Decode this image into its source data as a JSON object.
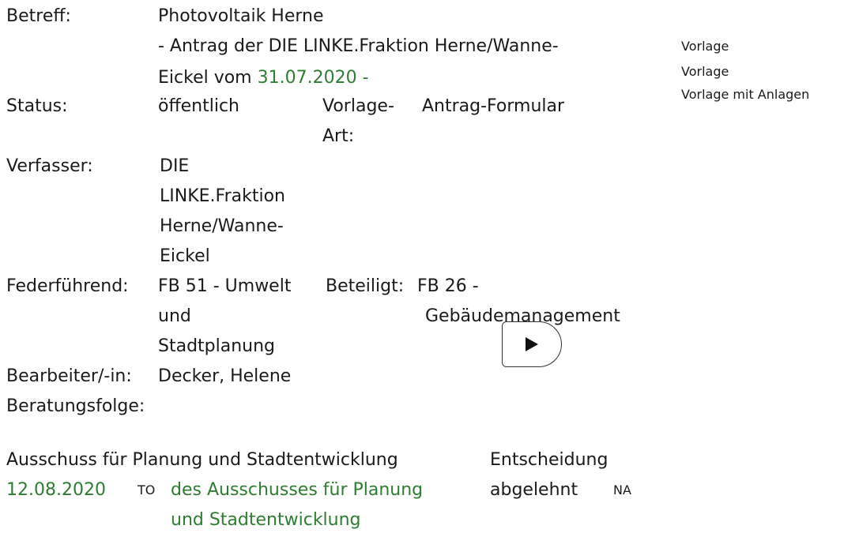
{
  "document": {
    "betreff_label": "Betreff:",
    "betreff_title": "Photovoltaik Herne",
    "betreff_sub1": "- Antrag der DIE LINKE.Fraktion Herne/Wanne-",
    "betreff_sub2_prefix": "Eickel vom",
    "betreff_date": "31.07.2020",
    "betreff_sub2_suffix": "-",
    "status_label": "Status:",
    "status_value": "öffentlich",
    "vorlage_art_label1": "Vorlage-",
    "vorlage_art_label2": "Art:",
    "vorlage_art_value": "Antrag-Formular",
    "verfasser_label": "Verfasser:",
    "verfasser_lines": [
      "DIE",
      "LINKE.Fraktion",
      "Herne/Wanne-",
      "Eickel"
    ],
    "federfuehrend_label": "Federführend:",
    "federfuehrend_lines": [
      "FB 51 - Umwelt",
      "und",
      "Stadtplanung"
    ],
    "beteiligt_label": "Beteiligt:",
    "beteiligt_lines": [
      "FB 26 -",
      "Gebäudemanagement"
    ],
    "bearbeiter_label": "Bearbeiter/-in:",
    "bearbeiter_value": "Decker, Helene",
    "beratungsfolge_label": "Beratungsfolge:"
  },
  "sidebar": {
    "links": [
      "Vorlage",
      "Vorlage",
      "Vorlage mit Anlagen"
    ]
  },
  "player": {
    "icon": "play-icon"
  },
  "beratung": {
    "committee": "Ausschuss für Planung und Stadtentwicklung",
    "role": "Entscheidung",
    "date": "12.08.2020",
    "to_badge": "TO",
    "session_line1": "des Ausschusses für Planung",
    "session_line2": "und Stadtentwicklung",
    "result": "abgelehnt",
    "na_badge": "NA"
  },
  "colors": {
    "link": "#2e7d32",
    "text": "#1a1a1a"
  }
}
